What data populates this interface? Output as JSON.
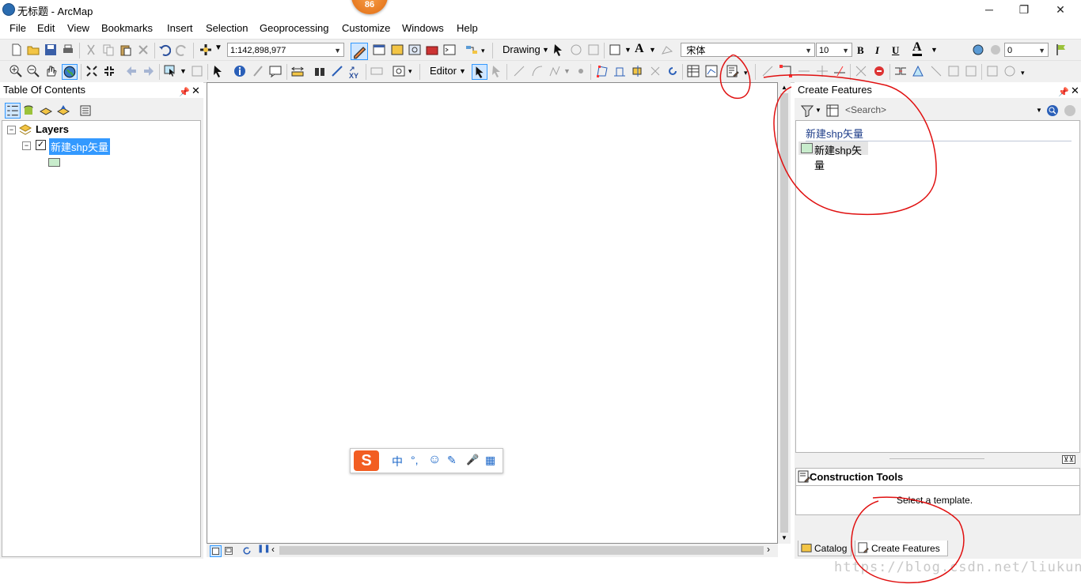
{
  "window": {
    "title": "无标题 - ArcMap",
    "notification_count": "86",
    "controls": [
      "minimize-icon",
      "restore-icon",
      "close-icon"
    ]
  },
  "menu": [
    "File",
    "Edit",
    "View",
    "Bookmarks",
    "Insert",
    "Selection",
    "Geoprocessing",
    "Customize",
    "Windows",
    "Help"
  ],
  "toolbar": {
    "scale": "1:142,898,977",
    "drawing_label": "Drawing",
    "font_name": "宋体",
    "font_size": "10",
    "bold": "B",
    "italic": "I",
    "underline": "U",
    "font_color_glyph": "A",
    "offset_value": "0",
    "editor_label": "Editor"
  },
  "toc": {
    "title": "Table Of Contents",
    "root_layer": "Layers",
    "layer": "新建shp矢量",
    "layer_checked": true,
    "symbol_color": "#c8eccc"
  },
  "create_features": {
    "title": "Create Features",
    "search_placeholder": "<Search>",
    "group_label": "新建shp矢量",
    "template_label": "新建shp矢量",
    "construction_tools_title": "Construction Tools",
    "construction_tools_message": "Select a template.",
    "tabs": [
      {
        "label": "Catalog",
        "active": false
      },
      {
        "label": "Create Features",
        "active": true
      }
    ]
  },
  "ime": {
    "logo": "S",
    "items": [
      "中",
      "°,",
      "☺",
      "✎",
      "🎤",
      "▦"
    ]
  },
  "watermark": "https://blog.csdn.net/liukunrs",
  "colors": {
    "annotation_red": "#e01010",
    "selection_blue": "#3399ff"
  }
}
